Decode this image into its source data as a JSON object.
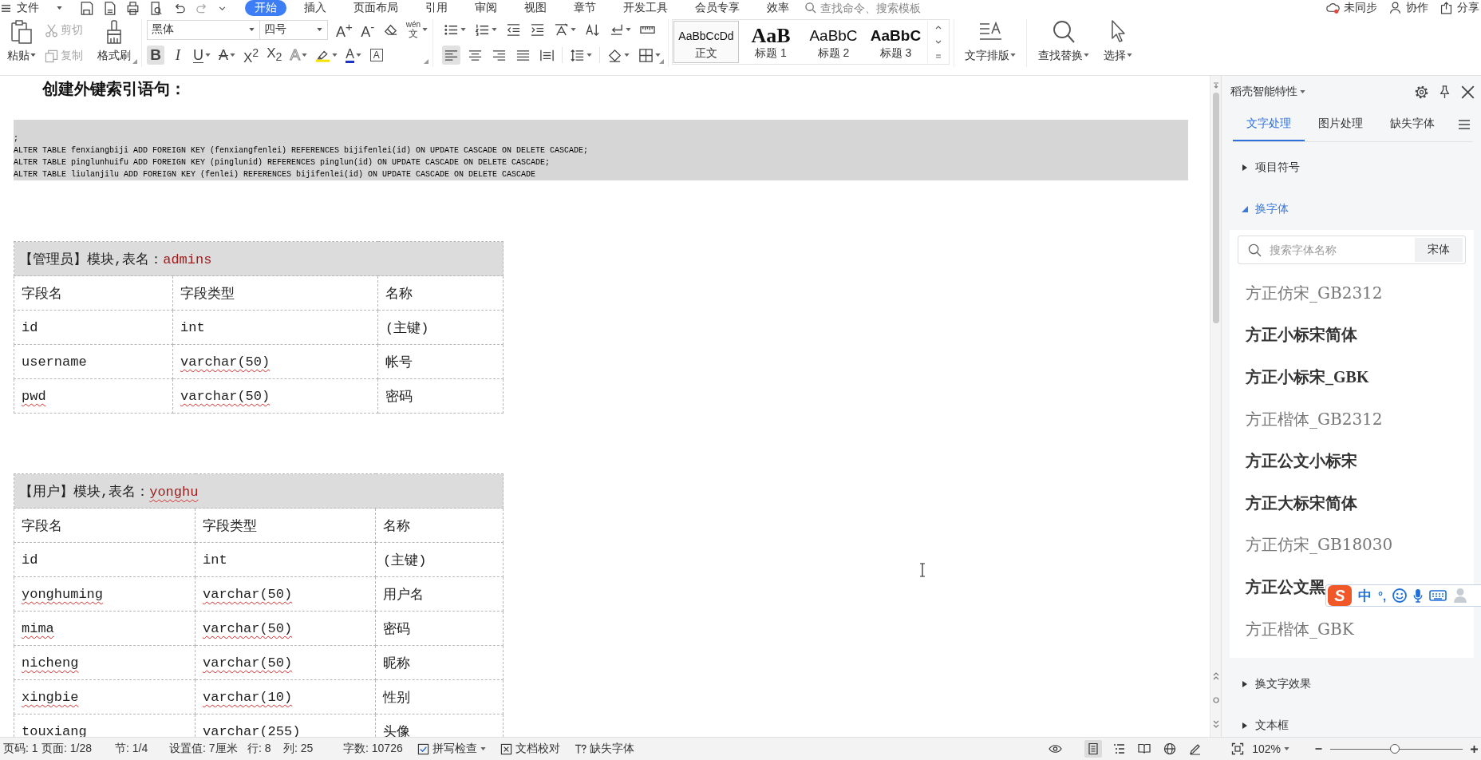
{
  "menu_bar": {
    "file_menu": {
      "label": "文件",
      "dropdown": true
    },
    "tabs": [
      {
        "label": "开始",
        "selected": true
      },
      {
        "label": "插入",
        "selected": false
      },
      {
        "label": "页面布局",
        "selected": false
      },
      {
        "label": "引用",
        "selected": false
      },
      {
        "label": "审阅",
        "selected": false
      },
      {
        "label": "视图",
        "selected": false
      },
      {
        "label": "章节",
        "selected": false
      },
      {
        "label": "开发工具",
        "selected": false
      },
      {
        "label": "会员专享",
        "selected": false
      },
      {
        "label": "效率",
        "selected": false
      }
    ],
    "search": {
      "placeholder": "查找命令、搜索模板"
    },
    "actions": [
      {
        "kind": "sync",
        "label": "未同步"
      },
      {
        "kind": "collaborate",
        "label": "协作"
      },
      {
        "kind": "share",
        "label": "分享"
      }
    ]
  },
  "ribbon": {
    "clipboard": {
      "paste": {
        "label": "粘贴",
        "dropdown": true
      },
      "cut": {
        "label": "剪切",
        "disabled": true
      },
      "copy": {
        "label": "复制",
        "disabled": true
      },
      "format_painter": {
        "label": "格式刷"
      }
    },
    "font": {
      "name": "黑体",
      "size": "四号",
      "row1": [
        {
          "kind": "grow",
          "label": "A$^{+}$",
          "selected": false,
          "dropdown": false
        },
        {
          "kind": "shrink",
          "label": "A$^{-}$",
          "selected": false,
          "dropdown": false
        },
        {
          "kind": "clear",
          "selected": false,
          "dropdown": false
        },
        {
          "kind": "pinyin",
          "label": "wén",
          "char": "文",
          "selected": false,
          "dropdown": true
        }
      ],
      "row2": [
        {
          "kind": "bold",
          "label": "B",
          "selected": true,
          "dropdown": false
        },
        {
          "kind": "italic",
          "label": "I",
          "selected": false,
          "dropdown": false
        },
        {
          "kind": "underline",
          "label": "U",
          "selected": false,
          "dropdown": true
        },
        {
          "kind": "strike",
          "label": "A",
          "selected": false,
          "dropdown": true
        },
        {
          "kind": "superscript",
          "label": "X$^{2}$",
          "selected": false,
          "dropdown": false
        },
        {
          "kind": "subscript",
          "label": "X$_{2}$",
          "selected": false,
          "dropdown": false
        },
        {
          "kind": "effect",
          "label": "A",
          "selected": false,
          "dropdown": true
        },
        {
          "kind": "highlight",
          "selected": false,
          "dropdown": true
        },
        {
          "kind": "font_color",
          "label": "A",
          "selected": false,
          "dropdown": true
        },
        {
          "kind": "border",
          "label": "A",
          "selected": false,
          "dropdown": false
        }
      ]
    },
    "paragraph": {
      "row1": [
        {
          "kind": "bullets",
          "selected": false,
          "dropdown": true
        },
        {
          "kind": "numbering",
          "selected": false,
          "dropdown": true
        },
        {
          "kind": "outdent",
          "selected": false,
          "dropdown": false
        },
        {
          "kind": "indent",
          "selected": false,
          "dropdown": false
        },
        {
          "kind": "asian_layout",
          "selected": false,
          "dropdown": true
        },
        {
          "kind": "sort",
          "selected": false,
          "dropdown": false
        },
        {
          "kind": "marks",
          "selected": false,
          "dropdown": true
        },
        {
          "kind": "ruler",
          "selected": false,
          "dropdown": false
        }
      ],
      "row2": [
        {
          "kind": "align_left",
          "selected": true,
          "dropdown": false
        },
        {
          "kind": "align_center",
          "selected": false,
          "dropdown": false
        },
        {
          "kind": "align_right",
          "selected": false,
          "dropdown": false
        },
        {
          "kind": "justify",
          "selected": false,
          "dropdown": false
        },
        {
          "kind": "distribute",
          "selected": false,
          "dropdown": false
        },
        {
          "kind": "line_spacing",
          "selected": false,
          "dropdown": true
        },
        {
          "kind": "shading",
          "selected": false,
          "dropdown": true
        },
        {
          "kind": "borders",
          "selected": false,
          "dropdown": true
        }
      ]
    },
    "styles": [
      {
        "kind": "normal",
        "preview": "AaBbCcDd",
        "label": "正文",
        "selected": true
      },
      {
        "kind": "heading1",
        "preview": "AaB",
        "label": "标题 1",
        "selected": false
      },
      {
        "kind": "heading2",
        "preview": "AaBbC",
        "label": "标题 2",
        "selected": false
      },
      {
        "kind": "heading3",
        "preview": "AaBbC",
        "label": "标题 3",
        "selected": false
      }
    ],
    "tools": [
      {
        "kind": "layout",
        "label": "文字排版",
        "dropdown": true
      },
      {
        "kind": "find",
        "label": "查找替换",
        "dropdown": true
      },
      {
        "kind": "select",
        "label": "选择",
        "dropdown": true
      }
    ]
  },
  "document": {
    "heading": "创建外键索引语句：",
    "code_lines": [
      ";",
      "ALTER TABLE fenxiangbiji ADD FOREIGN KEY (fenxiangfenlei) REFERENCES bijifenlei(id) ON UPDATE CASCADE ON DELETE CASCADE;",
      "ALTER TABLE pinglunhuifu ADD FOREIGN KEY (pinglunid) REFERENCES pinglun(id) ON UPDATE CASCADE ON DELETE CASCADE;",
      "ALTER TABLE liulanjilu ADD FOREIGN KEY (fenlei) REFERENCES bijifenlei(id) ON UPDATE CASCADE ON DELETE CASCADE"
    ],
    "tables": [
      {
        "caption": "【管理员】模块,表名：",
        "name": {
          "text": "admins",
          "misspelled": false
        },
        "columns": [
          "字段名",
          "字段类型",
          "名称"
        ],
        "rows": [
          [
            {
              "text": "id",
              "misspelled": false
            },
            {
              "text": "int",
              "misspelled": false
            },
            {
              "text": "(主键)",
              "misspelled": false
            }
          ],
          [
            {
              "text": "username",
              "misspelled": false
            },
            {
              "text": "varchar(50)",
              "misspelled": true
            },
            {
              "text": "帐号",
              "misspelled": false
            }
          ],
          [
            {
              "text": "pwd",
              "misspelled": true
            },
            {
              "text": "varchar(50)",
              "misspelled": true
            },
            {
              "text": "密码",
              "misspelled": false
            }
          ]
        ]
      },
      {
        "caption": "【用户】模块,表名：",
        "name": {
          "text": "yonghu",
          "misspelled": true
        },
        "columns": [
          "字段名",
          "字段类型",
          "名称"
        ],
        "rows": [
          [
            {
              "text": "id",
              "misspelled": false
            },
            {
              "text": "int",
              "misspelled": false
            },
            {
              "text": "(主键)",
              "misspelled": false
            }
          ],
          [
            {
              "text": "yonghuming",
              "misspelled": true
            },
            {
              "text": "varchar(50)",
              "misspelled": true
            },
            {
              "text": "用户名",
              "misspelled": false
            }
          ],
          [
            {
              "text": "mima",
              "misspelled": true
            },
            {
              "text": "varchar(50)",
              "misspelled": true
            },
            {
              "text": "密码",
              "misspelled": false
            }
          ],
          [
            {
              "text": "nicheng",
              "misspelled": true
            },
            {
              "text": "varchar(50)",
              "misspelled": true
            },
            {
              "text": "昵称",
              "misspelled": false
            }
          ],
          [
            {
              "text": "xingbie",
              "misspelled": true
            },
            {
              "text": "varchar(10)",
              "misspelled": true
            },
            {
              "text": "性别",
              "misspelled": false
            }
          ],
          [
            {
              "text": "touxiang"
            },
            {
              "text": "varchar(255)"
            },
            {
              "text": "头像"
            }
          ]
        ]
      }
    ]
  },
  "side_panel": {
    "title": "稻壳智能特性",
    "tabs": [
      {
        "label": "文字处理",
        "selected": true
      },
      {
        "label": "图片处理",
        "selected": false
      },
      {
        "label": "缺失字体",
        "selected": false
      }
    ],
    "sections": [
      {
        "label": "项目符号",
        "expanded": false
      },
      {
        "label": "换字体",
        "expanded": true,
        "search": {
          "placeholder": "搜索字体名称"
        },
        "current_font": "宋体",
        "fonts": [
          {
            "name": "方正仿宋_GB2312",
            "kind": "light"
          },
          {
            "name": "方正小标宋简体",
            "kind": "bold"
          },
          {
            "name": "方正小标宋_GBK",
            "kind": "bold"
          },
          {
            "name": "方正楷体_GB2312",
            "kind": "light"
          },
          {
            "name": "方正公文小标宋",
            "kind": "bold"
          },
          {
            "name": "方正大标宋简体",
            "kind": "bold"
          },
          {
            "name": "方正仿宋_GB18030",
            "kind": "light"
          },
          {
            "name": "方正公文黑",
            "kind": "bold"
          },
          {
            "name": "方正楷体_GBK",
            "kind": "light"
          }
        ]
      },
      {
        "label": "换文字效果",
        "expanded": false
      },
      {
        "label": "文本框",
        "expanded": false
      }
    ]
  },
  "ime_toolbar": {
    "logo": "S",
    "mode": "中",
    "punctuation": "°,"
  },
  "status_bar": {
    "items": [
      "页码: 1",
      "页面: 1/28",
      "节: 1/4",
      "设置值: 7厘米",
      "行: 8",
      "列: 25",
      "字数: 10726"
    ],
    "tools": [
      {
        "kind": "spellcheck",
        "label": "拼写检查",
        "dropdown": true
      },
      {
        "kind": "proofread",
        "label": "文档校对",
        "dropdown": false
      },
      {
        "kind": "missing_fonts",
        "label": "缺失字体",
        "dropdown": false
      }
    ],
    "views": [
      {
        "kind": "page",
        "selected": true
      },
      {
        "kind": "outline",
        "selected": false
      },
      {
        "kind": "reading",
        "selected": false
      },
      {
        "kind": "web",
        "selected": false
      },
      {
        "kind": "write",
        "selected": false
      }
    ],
    "zoom": {
      "label": "102%",
      "dropdown": true,
      "level": 0.49
    }
  }
}
